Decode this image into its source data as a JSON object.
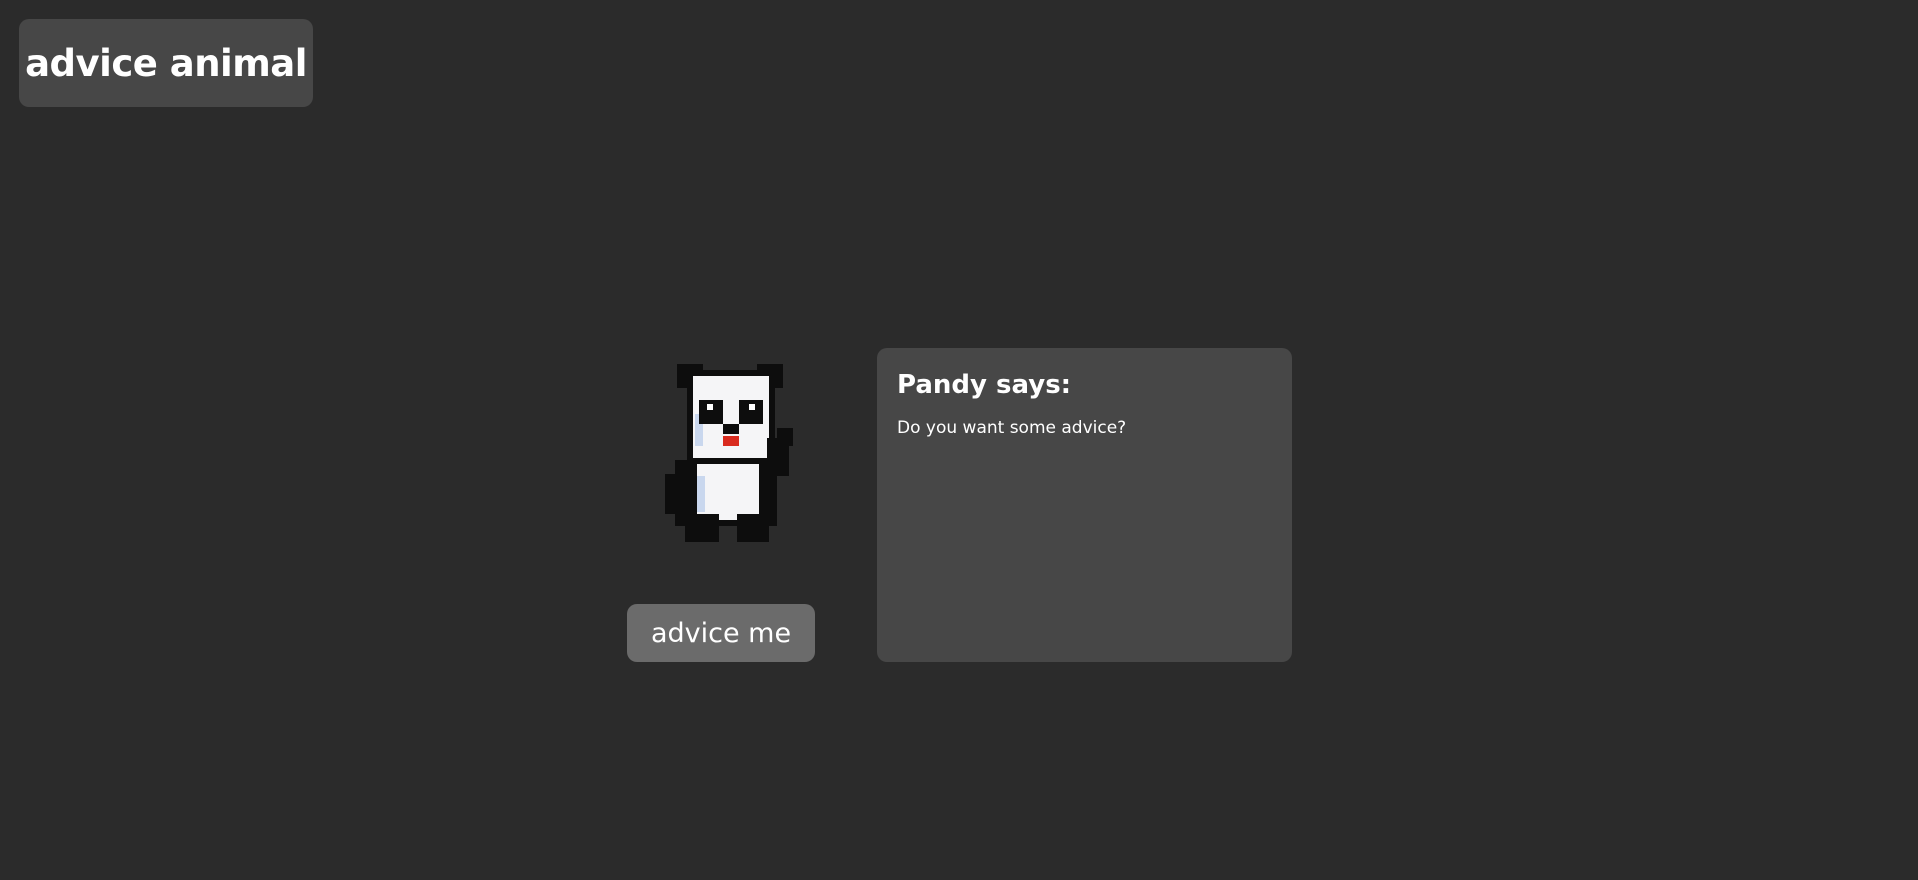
{
  "app": {
    "title": "advice animal"
  },
  "character": {
    "icon": "panda-icon",
    "name_line": "Pandy says:",
    "message": "Do you want some advice?"
  },
  "actions": {
    "advice_button_label": "advice me"
  },
  "colors": {
    "background": "#2b2b2b",
    "panel": "#474747",
    "button": "#6b6b6b",
    "text": "#ffffff"
  }
}
